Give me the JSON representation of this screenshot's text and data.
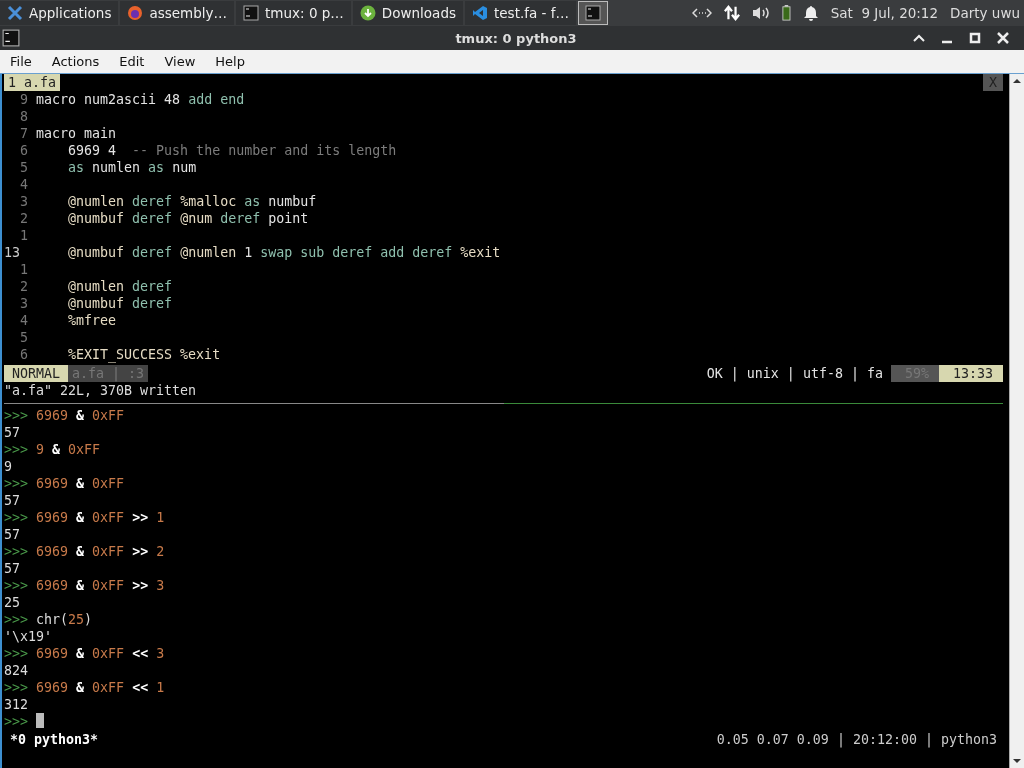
{
  "taskbar": {
    "items": [
      {
        "label": "Applications",
        "kind": "menu",
        "selected": false
      },
      {
        "label": "assembly…",
        "kind": "browser",
        "selected": false
      },
      {
        "label": "tmux: 0 p…",
        "kind": "terminal",
        "selected": false
      },
      {
        "label": "Downloads",
        "kind": "download",
        "selected": false
      },
      {
        "label": "test.fa - f…",
        "kind": "editor",
        "selected": false
      },
      {
        "kind": "terminal",
        "selected": true
      }
    ],
    "clock": "Sat  9 Jul, 20:12",
    "user": "Darty uwu"
  },
  "window": {
    "title": "tmux: 0 python3"
  },
  "menu": [
    "File",
    "Actions",
    "Edit",
    "View",
    "Help"
  ],
  "buffer_tab": {
    "label": "1 a.fa",
    "close": "X"
  },
  "editor": {
    "lines": [
      {
        "number": "9",
        "current": false,
        "indented": false,
        "tokens": [
          {
            "text": "macro num2ascii 48 ",
            "kind": "plain"
          },
          {
            "text": "add end",
            "kind": "kw"
          }
        ]
      },
      {
        "number": "8",
        "current": false
      },
      {
        "number": "7",
        "current": false,
        "indented": false,
        "tokens": [
          {
            "text": "macro main",
            "kind": "plain"
          }
        ]
      },
      {
        "number": "6",
        "current": false,
        "indented": true,
        "tokens": [
          {
            "text": "6969 4  ",
            "kind": "plain"
          },
          {
            "text": "-- Push the number and its length",
            "kind": "comment"
          }
        ]
      },
      {
        "number": "5",
        "current": false,
        "indented": true,
        "tokens": [
          {
            "text": "as ",
            "kind": "kw"
          },
          {
            "text": "numlen ",
            "kind": "plain"
          },
          {
            "text": "as ",
            "kind": "kw"
          },
          {
            "text": "num",
            "kind": "plain"
          }
        ]
      },
      {
        "number": "4",
        "current": false
      },
      {
        "number": "3",
        "current": false,
        "indented": true,
        "tokens": [
          {
            "text": "@numlen ",
            "kind": "attr"
          },
          {
            "text": "deref ",
            "kind": "kw"
          },
          {
            "text": "%malloc ",
            "kind": "attr"
          },
          {
            "text": "as ",
            "kind": "kw"
          },
          {
            "text": "numbuf",
            "kind": "plain"
          }
        ]
      },
      {
        "number": "2",
        "current": false,
        "indented": true,
        "tokens": [
          {
            "text": "@numbuf ",
            "kind": "attr"
          },
          {
            "text": "deref ",
            "kind": "kw"
          },
          {
            "text": "@num ",
            "kind": "attr"
          },
          {
            "text": "deref ",
            "kind": "kw"
          },
          {
            "text": "point",
            "kind": "plain"
          }
        ]
      },
      {
        "number": "1",
        "current": false
      },
      {
        "number": "13",
        "current": true,
        "indented": true,
        "tokens": [
          {
            "text": "@numbuf ",
            "kind": "attr"
          },
          {
            "text": "deref ",
            "kind": "kw"
          },
          {
            "text": "@numlen ",
            "kind": "attr"
          },
          {
            "text": "1 ",
            "kind": "plain"
          },
          {
            "text": "swap sub deref add deref ",
            "kind": "kw"
          },
          {
            "text": "%exit",
            "kind": "attr"
          }
        ]
      },
      {
        "number": "1",
        "current": false
      },
      {
        "number": "2",
        "current": false,
        "indented": true,
        "tokens": [
          {
            "text": "@numlen ",
            "kind": "attr"
          },
          {
            "text": "deref",
            "kind": "kw"
          }
        ]
      },
      {
        "number": "3",
        "current": false,
        "indented": true,
        "tokens": [
          {
            "text": "@numbuf ",
            "kind": "attr"
          },
          {
            "text": "deref",
            "kind": "kw"
          }
        ]
      },
      {
        "number": "4",
        "current": false,
        "indented": true,
        "tokens": [
          {
            "text": "%mfree",
            "kind": "attr"
          }
        ]
      },
      {
        "number": "5",
        "current": false
      },
      {
        "number": "6",
        "current": false,
        "indented": true,
        "tokens": [
          {
            "text": "%EXIT_SUCCESS %exit",
            "kind": "attr"
          }
        ]
      }
    ]
  },
  "vim_status": {
    "mode": "NORMAL",
    "file": "a.fa | :3",
    "info": "OK | unix | utf-8 | fa",
    "percent": "59%",
    "position": "13:33"
  },
  "message": "\"a.fa\" 22L, 370B written",
  "repl": {
    "lines": [
      {
        "tokens": [
          {
            "text": ">>> ",
            "kind": "prompt"
          },
          {
            "text": "6969",
            "kind": "number"
          },
          {
            "text": " & ",
            "kind": "op"
          },
          {
            "text": "0xFF",
            "kind": "number"
          }
        ]
      },
      {
        "tokens": [
          {
            "text": "57",
            "kind": "output"
          }
        ]
      },
      {
        "tokens": [
          {
            "text": ">>> ",
            "kind": "prompt"
          },
          {
            "text": "9",
            "kind": "number"
          },
          {
            "text": " & ",
            "kind": "op"
          },
          {
            "text": "0xFF",
            "kind": "number"
          }
        ]
      },
      {
        "tokens": [
          {
            "text": "9",
            "kind": "output"
          }
        ]
      },
      {
        "tokens": [
          {
            "text": ">>> ",
            "kind": "prompt"
          },
          {
            "text": "6969",
            "kind": "number"
          },
          {
            "text": " & ",
            "kind": "op"
          },
          {
            "text": "0xFF",
            "kind": "number"
          }
        ]
      },
      {
        "tokens": [
          {
            "text": "57",
            "kind": "output"
          }
        ]
      },
      {
        "tokens": [
          {
            "text": ">>> ",
            "kind": "prompt"
          },
          {
            "text": "6969",
            "kind": "number"
          },
          {
            "text": " & ",
            "kind": "op"
          },
          {
            "text": "0xFF",
            "kind": "number"
          },
          {
            "text": " >> ",
            "kind": "op"
          },
          {
            "text": "1",
            "kind": "number"
          }
        ]
      },
      {
        "tokens": [
          {
            "text": "57",
            "kind": "output"
          }
        ]
      },
      {
        "tokens": [
          {
            "text": ">>> ",
            "kind": "prompt"
          },
          {
            "text": "6969",
            "kind": "number"
          },
          {
            "text": " & ",
            "kind": "op"
          },
          {
            "text": "0xFF",
            "kind": "number"
          },
          {
            "text": " >> ",
            "kind": "op"
          },
          {
            "text": "2",
            "kind": "number"
          }
        ]
      },
      {
        "tokens": [
          {
            "text": "57",
            "kind": "output"
          }
        ]
      },
      {
        "tokens": [
          {
            "text": ">>> ",
            "kind": "prompt"
          },
          {
            "text": "6969",
            "kind": "number"
          },
          {
            "text": " & ",
            "kind": "op"
          },
          {
            "text": "0xFF",
            "kind": "number"
          },
          {
            "text": " >> ",
            "kind": "op"
          },
          {
            "text": "3",
            "kind": "number"
          }
        ]
      },
      {
        "tokens": [
          {
            "text": "25",
            "kind": "output"
          }
        ]
      },
      {
        "tokens": [
          {
            "text": ">>> ",
            "kind": "prompt"
          },
          {
            "text": "chr(",
            "kind": "output"
          },
          {
            "text": "25",
            "kind": "number"
          },
          {
            "text": ")",
            "kind": "output"
          }
        ]
      },
      {
        "tokens": [
          {
            "text": "'\\x19'",
            "kind": "output"
          }
        ]
      },
      {
        "tokens": [
          {
            "text": ">>> ",
            "kind": "prompt"
          },
          {
            "text": "6969",
            "kind": "number"
          },
          {
            "text": " & ",
            "kind": "op"
          },
          {
            "text": "0xFF",
            "kind": "number"
          },
          {
            "text": " << ",
            "kind": "op"
          },
          {
            "text": "3",
            "kind": "number"
          }
        ]
      },
      {
        "tokens": [
          {
            "text": "824",
            "kind": "output"
          }
        ]
      },
      {
        "tokens": [
          {
            "text": ">>> ",
            "kind": "prompt"
          },
          {
            "text": "6969",
            "kind": "number"
          },
          {
            "text": " & ",
            "kind": "op"
          },
          {
            "text": "0xFF",
            "kind": "number"
          },
          {
            "text": " << ",
            "kind": "op"
          },
          {
            "text": "1",
            "kind": "number"
          }
        ]
      },
      {
        "tokens": [
          {
            "text": "312",
            "kind": "output"
          }
        ]
      },
      {
        "cursor": true,
        "tokens": [
          {
            "text": ">>> ",
            "kind": "prompt"
          }
        ]
      }
    ]
  },
  "tmux_status": {
    "window": "*0 python3*",
    "right": "0.05 0.07 0.09 | 20:12:00 | python3"
  }
}
